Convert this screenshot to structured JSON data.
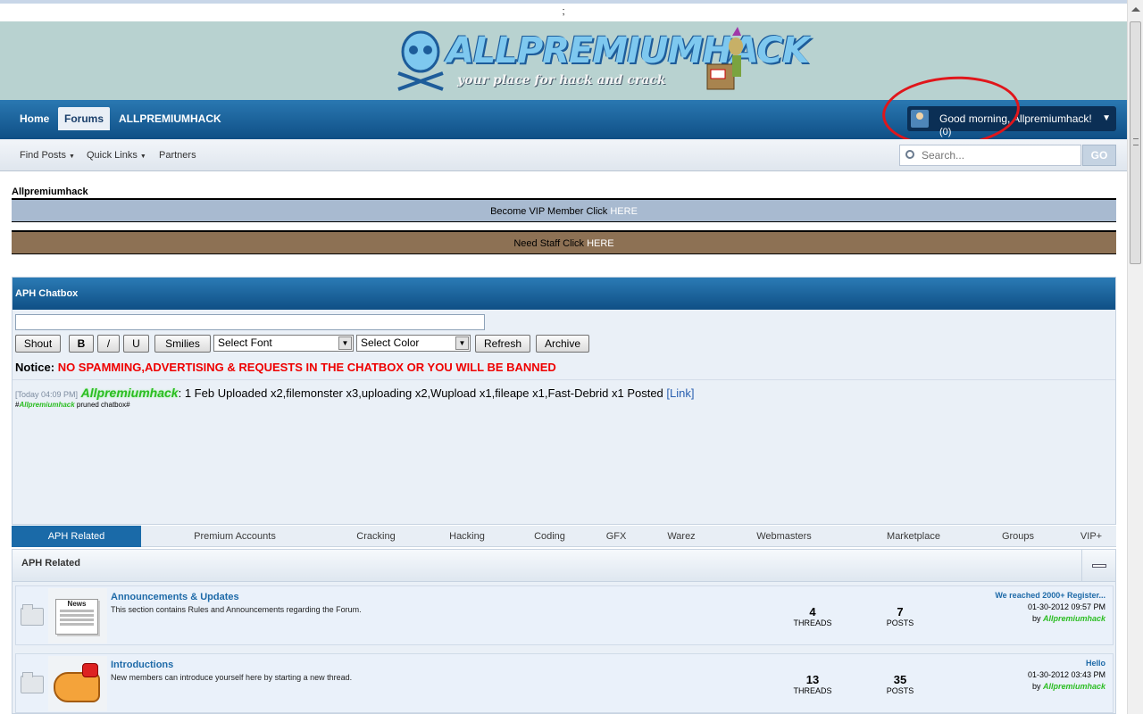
{
  "topstrip": {
    "text": ";"
  },
  "banner": {
    "logo_text": "ALLPREMIUMHACK",
    "logo_tagline": "your place for hack and crack"
  },
  "navbar": {
    "tabs": [
      {
        "label": "Home"
      },
      {
        "label": "Forums"
      },
      {
        "label": "ALLPREMIUMHACK"
      }
    ],
    "welcome": "Good morning, Allpremiumhack!",
    "notifications": "(0)"
  },
  "subnav": {
    "items": [
      {
        "label": "Find Posts"
      },
      {
        "label": "Quick Links"
      },
      {
        "label": "Partners"
      }
    ],
    "search_placeholder": "Search...",
    "go_label": "GO"
  },
  "forum_name": "Allpremiumhack",
  "vip_bar": {
    "text": "Become VIP Member Click ",
    "link": "HERE"
  },
  "staff_bar": {
    "text": "Need Staff Click ",
    "link": "HERE"
  },
  "chatbox": {
    "title": "APH Chatbox",
    "buttons": {
      "shout": "Shout",
      "bold": "B",
      "italic": "/",
      "underline": "U",
      "smilies": "Smilies",
      "refresh": "Refresh",
      "archive": "Archive"
    },
    "font_select": "Select Font",
    "color_select": "Select Color",
    "notice_label": "Notice",
    "notice_text": "NO SPAMMING,ADVERTISING & REQUESTS IN THE CHATBOX OR YOU WILL BE BANNED",
    "message": {
      "time": "[Today 04:09 PM]",
      "user": "Allpremiumhack",
      "text": ": 1 Feb Uploaded x2,filemonster x3,uploading x2,Wupload x1,fileape x1,Fast-Debrid x1 Posted ",
      "link": "[Link]"
    },
    "pruned": {
      "prefix": "#",
      "user": "Allpremiumhack",
      "suffix": " pruned chatbox#"
    }
  },
  "tabs": [
    {
      "label": "APH Related"
    },
    {
      "label": "Premium Accounts"
    },
    {
      "label": "Cracking"
    },
    {
      "label": "Hacking"
    },
    {
      "label": "Coding"
    },
    {
      "label": "GFX"
    },
    {
      "label": "Warez"
    },
    {
      "label": "Webmasters"
    },
    {
      "label": "Marketplace"
    },
    {
      "label": "Groups"
    },
    {
      "label": "VIP+"
    }
  ],
  "section": {
    "title": "APH Related",
    "forums": [
      {
        "title": "Announcements & Updates",
        "desc": "This section contains Rules and Announcements regarding the Forum.",
        "thumb_text": "News",
        "threads": "4",
        "threads_label": "THREADS",
        "posts": "7",
        "posts_label": "POSTS",
        "last_title": "We reached 2000+ Register...",
        "last_date": "01-30-2012 09:57 PM",
        "last_by": "by ",
        "last_user": "Allpremiumhack"
      },
      {
        "title": "Introductions",
        "desc": "New members can introduce yourself here by starting a new thread.",
        "threads": "13",
        "threads_label": "THREADS",
        "posts": "35",
        "posts_label": "POSTS",
        "last_title": "Hello",
        "last_date": "01-30-2012 03:43 PM",
        "last_by": "by ",
        "last_user": "Allpremiumhack"
      }
    ]
  }
}
